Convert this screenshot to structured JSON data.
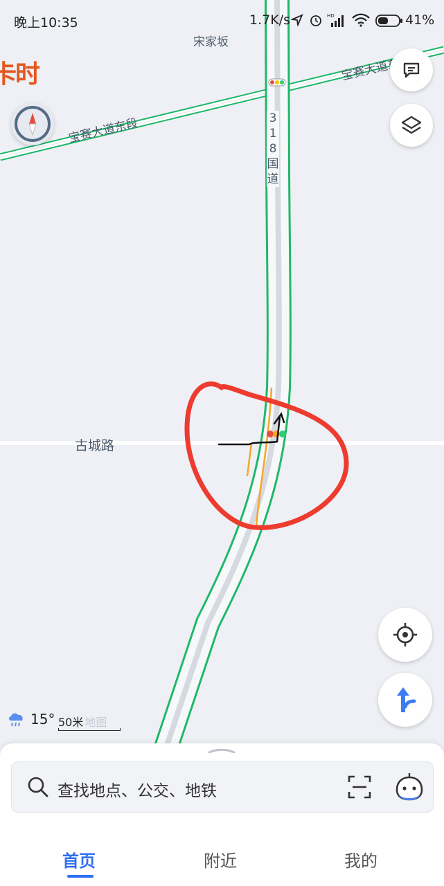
{
  "status_bar": {
    "time": "晚上10:35",
    "network_speed": "1.7K/s",
    "battery_percent": "41%",
    "icons": [
      "location-arrow-icon",
      "alarm-icon",
      "hd-signal-icon",
      "wifi-icon",
      "battery-icon"
    ]
  },
  "map": {
    "road_labels": {
      "top_village": "宋家坂",
      "baosai_left": "宝赛大道东段",
      "baosai_right": "宝赛大道东",
      "highway": "318国道",
      "gucheng": "古城路"
    },
    "banner_text": "卡时",
    "colors": {
      "road_outline": "#1fb86a",
      "road_fill": "#d9dce3",
      "annotation_circle": "#ee3b2f",
      "traffic_orange": "#f5a623"
    }
  },
  "controls": {
    "message_button": "message-icon",
    "layers_button": "layers-icon",
    "compass_button": "compass-icon",
    "locate_button": "locate-icon",
    "route_button": "route-icon"
  },
  "weather": {
    "temperature": "15°",
    "icon": "rain-cloud-icon"
  },
  "scale": {
    "label": "50米",
    "watermark": "地图"
  },
  "search": {
    "placeholder": "查找地点、公交、地铁"
  },
  "bottom_nav": {
    "home": "首页",
    "nearby": "附近",
    "mine": "我的"
  }
}
